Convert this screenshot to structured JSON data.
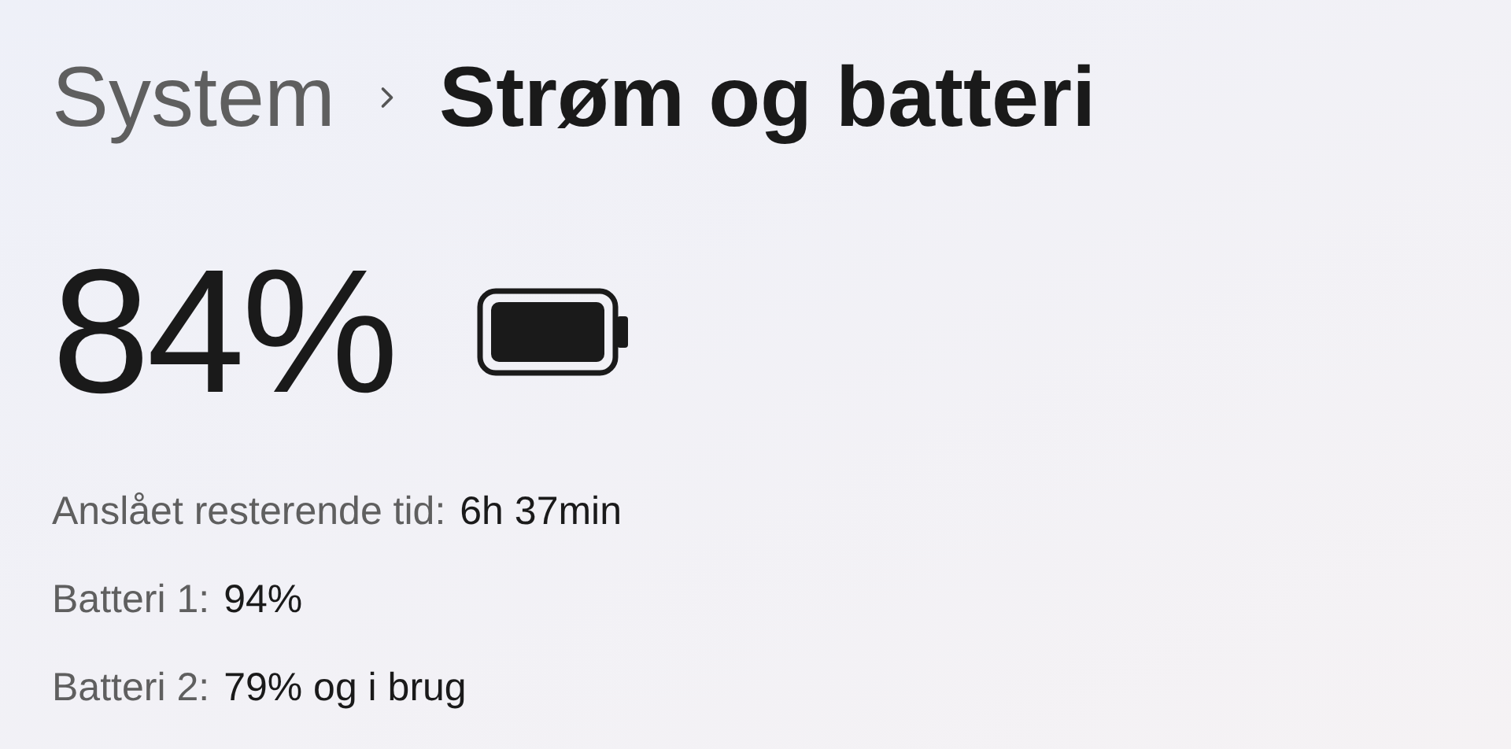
{
  "breadcrumb": [
    {
      "label": "System",
      "selected": false
    },
    {
      "label": "Strøm og batteri",
      "selected": true
    }
  ],
  "charge": "84%",
  "details": [
    {
      "label": "Anslået resterende tid:",
      "value": "6h 37min"
    },
    {
      "label": "Batteri 1:",
      "value": "94%"
    },
    {
      "label": "Batteri 2:",
      "value": "79% og i brug"
    }
  ]
}
